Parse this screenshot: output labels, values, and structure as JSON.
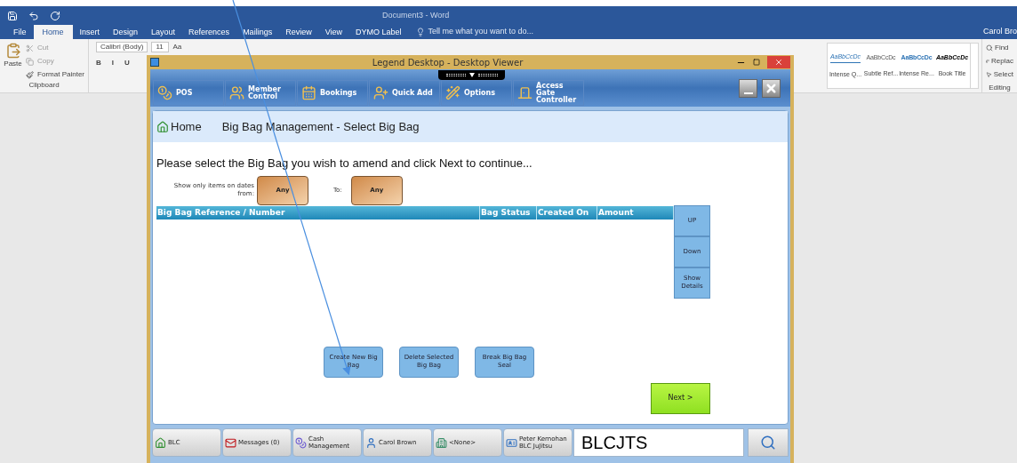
{
  "word": {
    "title": "Document3 - Word",
    "user": "Carol Bro",
    "tell_me": "Tell me what you want to do...",
    "tabs": [
      {
        "label": "File",
        "selected": false
      },
      {
        "label": "Home",
        "selected": true
      },
      {
        "label": "Insert",
        "selected": false
      },
      {
        "label": "Design",
        "selected": false
      },
      {
        "label": "Layout",
        "selected": false
      },
      {
        "label": "References",
        "selected": false
      },
      {
        "label": "Mailings",
        "selected": false
      },
      {
        "label": "Review",
        "selected": false
      },
      {
        "label": "View",
        "selected": false
      },
      {
        "label": "DYMO Label",
        "selected": false
      }
    ],
    "clipboard": {
      "paste": "Paste",
      "cut": "Cut",
      "copy": "Copy",
      "format_painter": "Format Painter",
      "group": "Clipboard"
    },
    "font": {
      "name": "Calibri (Body)",
      "size": "11",
      "case": "Aa",
      "format_buttons": [
        "B",
        "I",
        "U"
      ]
    },
    "styles": [
      {
        "kind": "quote",
        "sample": "AaBbCcDc",
        "name": "Intense Q..."
      },
      {
        "kind": "subtle",
        "sample": "AaBbCcDc",
        "name": "Subtle Ref..."
      },
      {
        "kind": "intense",
        "sample": "AaBbCcDc",
        "name": "Intense Re..."
      },
      {
        "kind": "title",
        "sample": "AaBbCcDc",
        "name": "Book Title"
      }
    ],
    "editing": {
      "find": "Find",
      "replace": "Replac",
      "select": "Select",
      "group": "Editing"
    }
  },
  "viewer": {
    "title": "Legend Desktop - Desktop Viewer",
    "toolbar": [
      {
        "kind": "pos",
        "label": "POS"
      },
      {
        "kind": "member",
        "label": "Member Control"
      },
      {
        "kind": "bookings",
        "label": "Bookings"
      },
      {
        "kind": "add",
        "label": "Quick Add"
      },
      {
        "kind": "options",
        "label": "Options"
      },
      {
        "kind": "gate",
        "label": "Access Gate Controller"
      }
    ],
    "breadcrumb": {
      "home": "Home",
      "page": "Big Bag Management - Select Big Bag"
    },
    "instruction": "Please select the Big Bag you wish to amend and click Next to continue...",
    "filter": {
      "label": "Show only items on dates from:",
      "from": "Any",
      "to_label": "To:",
      "to": "Any"
    },
    "table": {
      "columns": [
        "Big Bag Reference / Number",
        "Bag Status",
        "Created On",
        "Amount"
      ]
    },
    "side_buttons": [
      "UP",
      "Down",
      "Show Details"
    ],
    "actions": [
      "Create New Big Bag",
      "Delete Selected Big Bag",
      "Break Big Bag Seal"
    ],
    "next": "Next >",
    "status_bar": [
      {
        "kind": "site",
        "label": "BLC"
      },
      {
        "kind": "messages",
        "label": "Messages (0)"
      },
      {
        "kind": "cash",
        "label": "Cash Management"
      },
      {
        "kind": "user",
        "label": "Carol Brown"
      },
      {
        "kind": "group",
        "label": "<None>"
      },
      {
        "kind": "card",
        "label": "Peter Kernohan BLC JuJitsu"
      }
    ],
    "code_field": "BLCJTS"
  }
}
